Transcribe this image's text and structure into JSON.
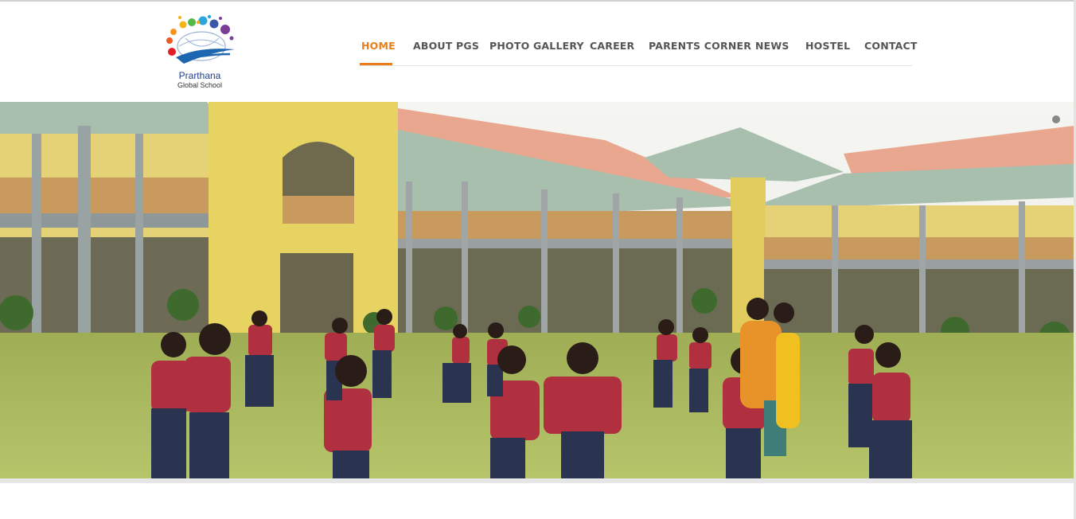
{
  "brand": {
    "name_line1": "Prarthana",
    "name_line2": "Global School"
  },
  "nav": {
    "items": [
      {
        "label": "HOME",
        "active": true
      },
      {
        "label": "ABOUT PGS",
        "active": false
      },
      {
        "label": "PHOTO GALLERY",
        "active": false
      },
      {
        "label": "CAREER",
        "active": false
      },
      {
        "label": "PARENTS CORNER",
        "active": false
      },
      {
        "label": "NEWS",
        "active": false
      },
      {
        "label": "HOSTEL",
        "active": false
      },
      {
        "label": "CONTACT",
        "active": false
      }
    ]
  },
  "colors": {
    "accent": "#e87e1b",
    "nav_text": "#555555",
    "building_yellow": "#e7d26a",
    "roof_green": "#a9bfae",
    "roof_red": "#e89b82",
    "lawn": "#a5b65a",
    "uniform_red": "#b03040",
    "pants_blue": "#2a3350"
  },
  "slider": {
    "dot_count": 1,
    "active_index": 0
  }
}
